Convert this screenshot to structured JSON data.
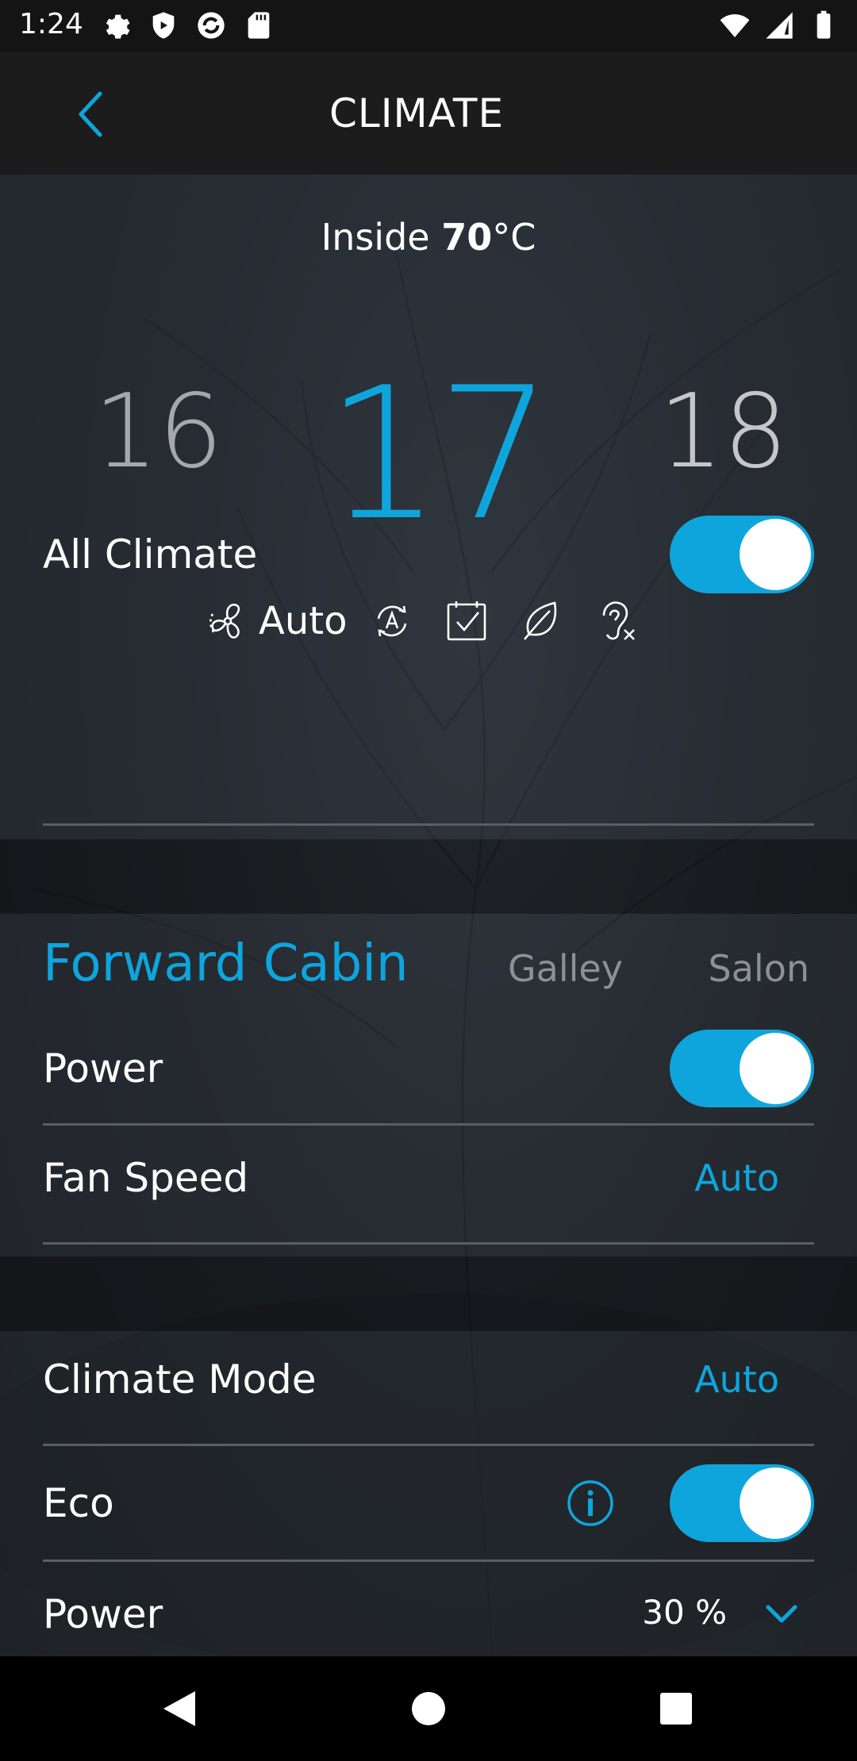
{
  "status_bar": {
    "time": "1:24",
    "icons_left": [
      "settings-icon",
      "shield-icon",
      "sync-icon",
      "sd-card-icon"
    ],
    "icons_right": [
      "wifi-icon",
      "signal-icon",
      "battery-icon"
    ]
  },
  "app_bar": {
    "title": "CLIMATE",
    "back_icon": "chevron-left-icon",
    "accent_color": "#0ea5dd"
  },
  "climate": {
    "inside_label": "Inside",
    "inside_value": "70",
    "inside_unit": "°C",
    "temp_prev": "16",
    "temp_current": "17",
    "temp_next": "18",
    "modes": {
      "fan_label": "Auto",
      "icons": [
        "fan-icon",
        "auto-cycle-icon",
        "schedule-check-icon",
        "eco-leaf-icon",
        "quiet-mode-icon"
      ]
    },
    "all_climate": {
      "label": "All Climate",
      "on": true
    }
  },
  "zones": {
    "tabs": [
      "Forward Cabin",
      "Galley",
      "Salon"
    ],
    "active_tab": "Forward Cabin"
  },
  "zone_settings": {
    "power": {
      "label": "Power",
      "on": true
    },
    "fan_speed": {
      "label": "Fan Speed",
      "value": "Auto"
    }
  },
  "advanced": {
    "climate_mode": {
      "label": "Climate Mode",
      "value": "Auto"
    },
    "eco": {
      "label": "Eco",
      "on": true
    },
    "power": {
      "label": "Power",
      "value": "30 %"
    }
  },
  "nav_bar": {
    "buttons": [
      "back-triangle-icon",
      "home-circle-icon",
      "recents-square-icon"
    ]
  }
}
